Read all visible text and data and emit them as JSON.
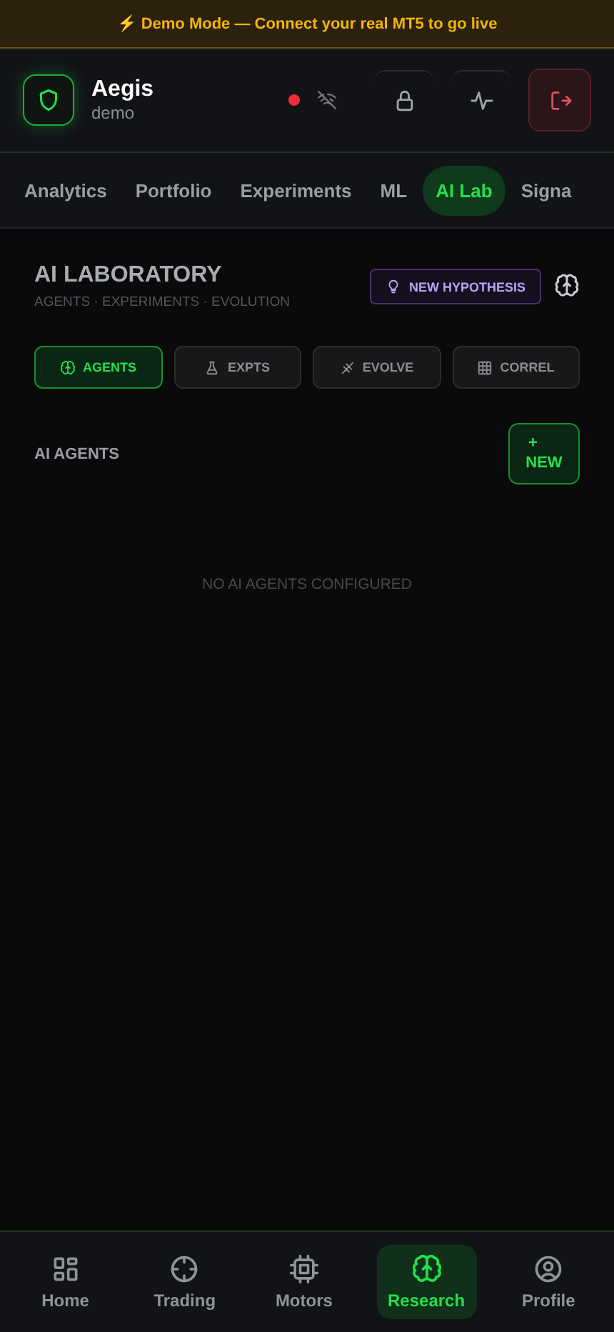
{
  "banner": {
    "text": "⚡ Demo Mode — Connect your real MT5 to go live"
  },
  "header": {
    "title": "Aegis",
    "subtitle": "demo",
    "connected": false
  },
  "tabs": [
    {
      "label": "Analytics",
      "selected": false
    },
    {
      "label": "Portfolio",
      "selected": false
    },
    {
      "label": "Experiments",
      "selected": false
    },
    {
      "label": "ML",
      "selected": false
    },
    {
      "label": "AI Lab",
      "selected": true
    },
    {
      "label": "Signa",
      "selected": false
    }
  ],
  "lab": {
    "title": "AI LABORATORY",
    "subtitle": "AGENTS · EXPERIMENTS · EVOLUTION",
    "hypothesis_button": "NEW HYPOTHESIS",
    "segments": [
      {
        "label": "AGENTS",
        "selected": true
      },
      {
        "label": "EXPTS",
        "selected": false
      },
      {
        "label": "EVOLVE",
        "selected": false
      },
      {
        "label": "CORREL",
        "selected": false
      }
    ],
    "section_title": "AI AGENTS",
    "new_button_icon": "+",
    "new_button": "NEW",
    "empty_text": "NO AI AGENTS CONFIGURED"
  },
  "bottom_nav": [
    {
      "label": "Home",
      "selected": false
    },
    {
      "label": "Trading",
      "selected": false
    },
    {
      "label": "Motors",
      "selected": false
    },
    {
      "label": "Research",
      "selected": true
    },
    {
      "label": "Profile",
      "selected": false
    }
  ]
}
